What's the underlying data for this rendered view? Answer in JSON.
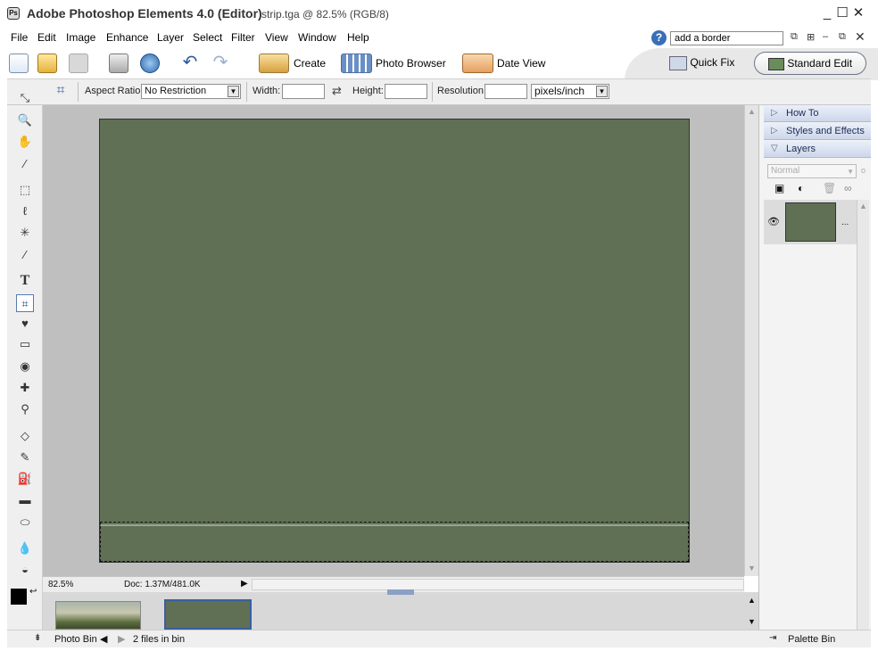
{
  "window": {
    "app_title": "Adobe Photoshop Elements 4.0 (Editor)",
    "doc_title": "strip.tga @ 82.5% (RGB/8)",
    "minimize": "_",
    "maximize": "☐",
    "close": "✕"
  },
  "menu": {
    "items": [
      "File",
      "Edit",
      "Image",
      "Enhance",
      "Layer",
      "Select",
      "Filter",
      "View",
      "Window",
      "Help"
    ],
    "search_value": "add a border",
    "help_glyph": "?"
  },
  "shortcuts": {
    "create": "Create",
    "photo_browser": "Photo Browser",
    "date_view": "Date View",
    "quick_fix": "Quick Fix",
    "standard_edit": "Standard Edit"
  },
  "options": {
    "aspect_label": "Aspect Ratio:",
    "aspect_value": "No Restriction",
    "width_label": "Width:",
    "height_label": "Height:",
    "resolution_label": "Resolution:",
    "unit_value": "pixels/inch"
  },
  "status": {
    "zoom": "82.5%",
    "doc_info": "Doc: 1.37M/481.0K"
  },
  "palette": {
    "how_to": "How To",
    "styles_effects": "Styles and Effects",
    "layers": "Layers",
    "blend_mode": "Normal",
    "layer_menu": "..."
  },
  "bottom": {
    "photo_bin": "Photo Bin",
    "files_count": "2 files in bin",
    "palette_bin": "Palette Bin"
  },
  "colors": {
    "canvas_fill": "#5f7055",
    "workspace": "#bfbfbf",
    "foreground": "#000000",
    "background": "#ffffff"
  }
}
